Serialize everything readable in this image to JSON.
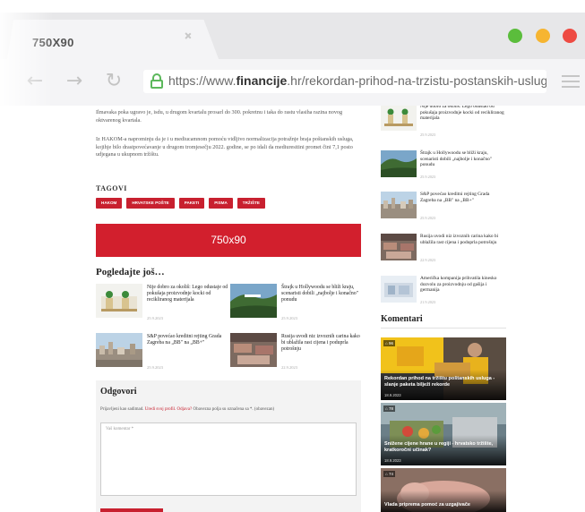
{
  "browser": {
    "tab_title": "750X90",
    "url_prefix": "https://www.",
    "url_domain": "financije",
    "url_rest": ".hr/rekordan-prihod-na-trzistu-postanskih-usluga-slan",
    "icons": [
      "back-arrow-icon",
      "forward-arrow-icon",
      "reload-icon",
      "lock-icon",
      "menu-icon",
      "tab-close-icon"
    ],
    "window_buttons": [
      "#5bbd3c",
      "#f6b531",
      "#ee4b43"
    ]
  },
  "article": {
    "para1": "Ilmavaka poka ugravo je, isdu, u drugom kvartalu prosarl do 300. pokretnu i taka do rastu vlasiha razina novog oktvarenog kvartala.",
    "para2": "Iz HAKOM-a naprominju da je i u mediucamnom pomoću vidljivo normalizacija potražnje braja poštanskih usluga, kojihje bilo drastpovećavanje u drugom tromjesečju 2022. godine, se po idali da mediuresitini promet čini 7,1 posto udjegana u ukupnom tržištu.",
    "tags_label": "TAGOVI",
    "tags": [
      "HAKOM",
      "HRVATSKE POŠTE",
      "PAKETI",
      "PISMA",
      "TRŽIŠTE"
    ],
    "ad_label": "750x90",
    "more_title": "Pogledajte još…",
    "cards": [
      {
        "title": "Nije dobro za okoliš: Lego odustaje od pokušaja proizvodnje kocki od recikliranog materijala",
        "date": "25.9.2023"
      },
      {
        "title": "Štrajk u Hollywoodu se bliži kraju, scenaristi dobili „najbolje i konačno\" ponudu",
        "date": "25.9.2023"
      },
      {
        "title": "S&P povećao kreditni rejting Grada Zagreba na „BB\" na „BB+\"",
        "date": "25.9.2023"
      },
      {
        "title": "Rusija uvodi niz izvoznih carina kako bi ublažila rast cijena i poduprla potrošnju",
        "date": "22.9.2023"
      }
    ]
  },
  "reply": {
    "title": "Odgovori",
    "note_before": "Prijavljeni kao sadimad. ",
    "note_link": "Uredi svoj profil. Odjava?",
    "note_after": " Obavezna polja su označena sa *. (obavezan)",
    "placeholder": "Vaš komentar *"
  },
  "sidebar": {
    "items": [
      {
        "title": "Nije dobro za okoliš: Lego odustao od pokušaja proizvodnje kocki od recikliranog materijala",
        "date": "25.9.2023"
      },
      {
        "title": "Štrajk u Hollywoodu se bliži kraju, scenaristi dobili „najbolje i konačno\" ponudu",
        "date": "25.9.2023"
      },
      {
        "title": "S&P povećao kreditni rejting Grada Zagreba na „BB\" na „BB+\"",
        "date": "25.9.2023"
      },
      {
        "title": "Rusija uvodi niz izvoznih carina kako bi ublažila rast cijena i poduprla potrošnju",
        "date": "22.9.2023"
      },
      {
        "title": "Američka kompanija prihvatila kinesko dozvolu za proizvodnju od gašija i germanija",
        "date": "21.9.2023"
      }
    ],
    "komentari_title": "Komentari",
    "featured": [
      {
        "badge": "⌂ 96",
        "title": "Rekordan prihod na tržištu poštanskih usluga - slanje paketa bilježi rekorde",
        "date": "18.9.2023"
      },
      {
        "badge": "⌂ 78",
        "title": "Snižene cijene hrane u regiji - hrvatsko tržište, kratkoročni učinak?",
        "date": "18.9.2023"
      },
      {
        "badge": "⌂ 74",
        "title": "Vlada priprema pomoć za uzgajivače",
        "date": ""
      }
    ]
  }
}
